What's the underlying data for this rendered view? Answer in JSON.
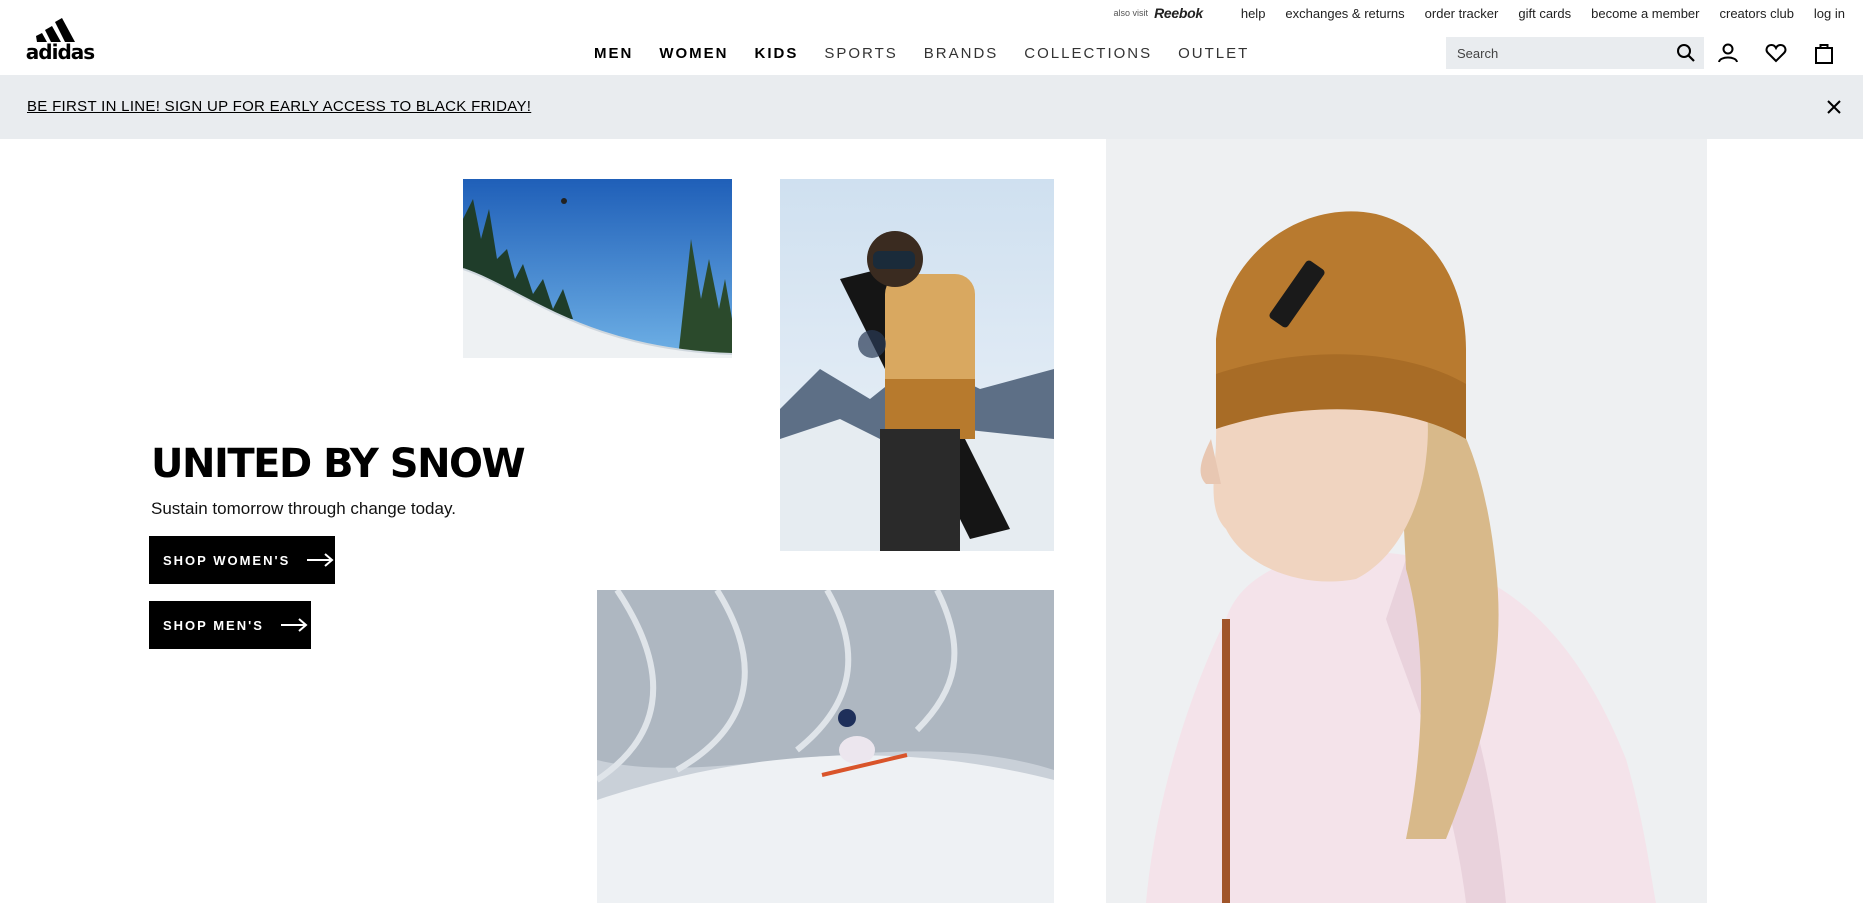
{
  "brand": {
    "logo_text": "adidas"
  },
  "utility_bar": {
    "also_visit_label": "also visit",
    "also_visit_brand": "Reebok",
    "links": [
      "help",
      "exchanges & returns",
      "order tracker",
      "gift cards",
      "become a member",
      "creators club",
      "log in"
    ]
  },
  "nav": {
    "items": [
      "MEN",
      "WOMEN",
      "KIDS",
      "SPORTS",
      "BRANDS",
      "COLLECTIONS",
      "OUTLET"
    ]
  },
  "search": {
    "placeholder": "Search"
  },
  "icons": {
    "search": "search-icon",
    "account": "user-icon",
    "wishlist": "heart-icon",
    "bag": "shopping-bag-icon",
    "close": "close-icon",
    "arrow": "arrow-right-icon"
  },
  "banner": {
    "text": "BE FIRST IN LINE! SIGN UP FOR EARLY ACCESS TO BLACK FRIDAY!"
  },
  "hero": {
    "title": "UNITED BY SNOW",
    "subtitle": "Sustain tomorrow through change today.",
    "cta_women": "SHOP WOMEN'S",
    "cta_men": "SHOP MEN'S"
  },
  "colors": {
    "banner_bg": "#e9ecef",
    "search_bg": "#e9ecef",
    "text": "#000000",
    "cta_bg": "#000000"
  }
}
